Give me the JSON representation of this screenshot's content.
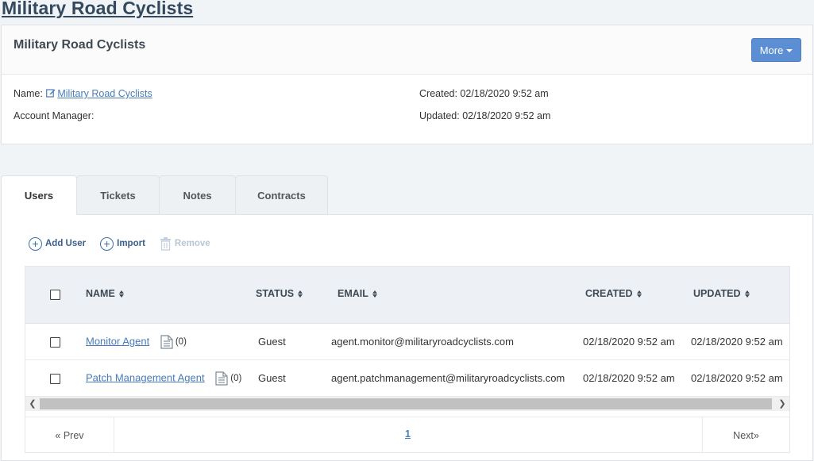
{
  "page": {
    "heading": "Military Road Cyclists"
  },
  "panel": {
    "title": "Military Road Cyclists",
    "more_label": "More",
    "name_label": "Name:",
    "name_value": "Military Road Cyclists",
    "account_manager_label": "Account Manager:",
    "created_text": "Created: 02/18/2020 9:52 am",
    "updated_text": "Updated: 02/18/2020 9:52 am"
  },
  "tabs": [
    {
      "label": "Users",
      "active": true
    },
    {
      "label": "Tickets"
    },
    {
      "label": "Notes"
    },
    {
      "label": "Contracts"
    }
  ],
  "toolbar": {
    "add_user": "Add User",
    "import": "Import",
    "remove": "Remove"
  },
  "table": {
    "columns": [
      "NAME",
      "STATUS",
      "EMAIL",
      "CREATED",
      "UPDATED"
    ],
    "rows": [
      {
        "name": "Monitor Agent",
        "notes_count": "(0)",
        "status": "Guest",
        "email": "agent.monitor@militaryroadcyclists.com",
        "created": "02/18/2020 9:52 am",
        "updated": "02/18/2020 9:52 am"
      },
      {
        "name": "Patch Management Agent",
        "notes_count": "(0)",
        "status": "Guest",
        "email": "agent.patchmanagement@militaryroadcyclists.com",
        "created": "02/18/2020 9:52 am",
        "updated": "02/18/2020 9:52 am"
      }
    ]
  },
  "pager": {
    "prev": "« Prev",
    "current_page": "1",
    "next": "Next»"
  },
  "colors": {
    "accent": "#5b8ed2",
    "link": "#4a7db8",
    "header_bg": "#edf1f5"
  }
}
